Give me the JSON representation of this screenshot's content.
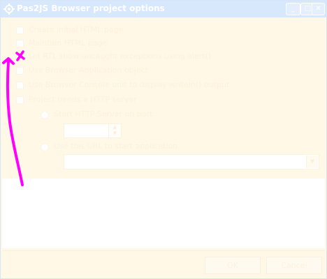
{
  "window": {
    "title": "Pas2JS Browser project options"
  },
  "titlebar": {
    "icon": "app-gear-icon",
    "minimize_glyph": "_",
    "maximize_glyph": "□",
    "close_glyph": "✕"
  },
  "options": {
    "create_html": {
      "label": "Create initial HTML page",
      "checked": false
    },
    "maintain_html": {
      "label": "Maintain HTML page",
      "checked": false
    },
    "run_rtl_auto": {
      "label": "Let RTL show uncaught exceptions using alert()",
      "checked": false
    },
    "use_browser_app": {
      "label": "Use Browser Application object",
      "checked": false
    },
    "use_browser_console": {
      "label": "Use Browser Console unit to display writeln() output",
      "checked": false
    },
    "project_needs_server": {
      "label": "Project needs a HTTP server",
      "checked": false
    }
  },
  "server": {
    "start_radio_label": "Start HTTP Server on port",
    "port_value": "",
    "use_url_radio_label": "Use this URL to start application",
    "url_value": ""
  },
  "buttons": {
    "ok": "OK",
    "cancel": "Cancel"
  },
  "colors": {
    "titlebar": "#d7e7fc",
    "window_bg": "#fff8e6",
    "annotation": "#ff00ff"
  }
}
